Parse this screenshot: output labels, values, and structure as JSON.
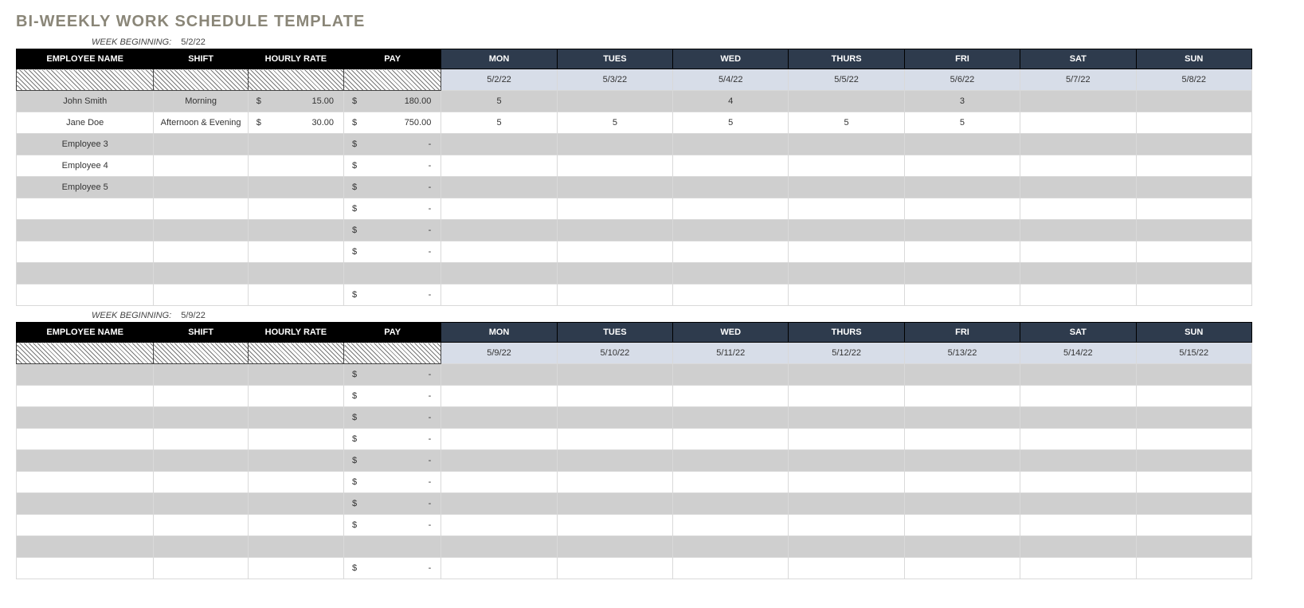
{
  "title": "BI-WEEKLY WORK SCHEDULE TEMPLATE",
  "week_beginning_label": "WEEK BEGINNING:",
  "columns": {
    "employee": "EMPLOYEE NAME",
    "shift": "SHIFT",
    "rate": "HOURLY RATE",
    "pay": "PAY",
    "days": [
      "MON",
      "TUES",
      "WED",
      "THURS",
      "FRI",
      "SAT",
      "SUN"
    ]
  },
  "currency": "$",
  "weeks": [
    {
      "begin_date": "5/2/22",
      "dates": [
        "5/2/22",
        "5/3/22",
        "5/4/22",
        "5/5/22",
        "5/6/22",
        "5/7/22",
        "5/8/22"
      ],
      "rows": [
        {
          "name": "John Smith",
          "shift": "Morning",
          "rate": "15.00",
          "pay": "180.00",
          "hours": [
            "5",
            "",
            "4",
            "",
            "3",
            "",
            ""
          ]
        },
        {
          "name": "Jane Doe",
          "shift": "Afternoon & Evening",
          "rate": "30.00",
          "pay": "750.00",
          "hours": [
            "5",
            "5",
            "5",
            "5",
            "5",
            "",
            ""
          ]
        },
        {
          "name": "Employee 3",
          "shift": "",
          "rate": "",
          "pay": "-",
          "hours": [
            "",
            "",
            "",
            "",
            "",
            "",
            ""
          ]
        },
        {
          "name": "Employee 4",
          "shift": "",
          "rate": "",
          "pay": "-",
          "hours": [
            "",
            "",
            "",
            "",
            "",
            "",
            ""
          ]
        },
        {
          "name": "Employee 5",
          "shift": "",
          "rate": "",
          "pay": "-",
          "hours": [
            "",
            "",
            "",
            "",
            "",
            "",
            ""
          ]
        },
        {
          "name": "",
          "shift": "",
          "rate": "",
          "pay": "-",
          "hours": [
            "",
            "",
            "",
            "",
            "",
            "",
            ""
          ]
        },
        {
          "name": "",
          "shift": "",
          "rate": "",
          "pay": "-",
          "hours": [
            "",
            "",
            "",
            "",
            "",
            "",
            ""
          ]
        },
        {
          "name": "",
          "shift": "",
          "rate": "",
          "pay": "-",
          "hours": [
            "",
            "",
            "",
            "",
            "",
            "",
            ""
          ]
        },
        {
          "name": "",
          "shift": "",
          "rate": "",
          "pay": "",
          "hours": [
            "",
            "",
            "",
            "",
            "",
            "",
            ""
          ],
          "no_currency": true
        },
        {
          "name": "",
          "shift": "",
          "rate": "",
          "pay": "-",
          "hours": [
            "",
            "",
            "",
            "",
            "",
            "",
            ""
          ]
        }
      ]
    },
    {
      "begin_date": "5/9/22",
      "dates": [
        "5/9/22",
        "5/10/22",
        "5/11/22",
        "5/12/22",
        "5/13/22",
        "5/14/22",
        "5/15/22"
      ],
      "rows": [
        {
          "name": "",
          "shift": "",
          "rate": "",
          "pay": "-",
          "hours": [
            "",
            "",
            "",
            "",
            "",
            "",
            ""
          ]
        },
        {
          "name": "",
          "shift": "",
          "rate": "",
          "pay": "-",
          "hours": [
            "",
            "",
            "",
            "",
            "",
            "",
            ""
          ]
        },
        {
          "name": "",
          "shift": "",
          "rate": "",
          "pay": "-",
          "hours": [
            "",
            "",
            "",
            "",
            "",
            "",
            ""
          ]
        },
        {
          "name": "",
          "shift": "",
          "rate": "",
          "pay": "-",
          "hours": [
            "",
            "",
            "",
            "",
            "",
            "",
            ""
          ]
        },
        {
          "name": "",
          "shift": "",
          "rate": "",
          "pay": "-",
          "hours": [
            "",
            "",
            "",
            "",
            "",
            "",
            ""
          ]
        },
        {
          "name": "",
          "shift": "",
          "rate": "",
          "pay": "-",
          "hours": [
            "",
            "",
            "",
            "",
            "",
            "",
            ""
          ]
        },
        {
          "name": "",
          "shift": "",
          "rate": "",
          "pay": "-",
          "hours": [
            "",
            "",
            "",
            "",
            "",
            "",
            ""
          ]
        },
        {
          "name": "",
          "shift": "",
          "rate": "",
          "pay": "-",
          "hours": [
            "",
            "",
            "",
            "",
            "",
            "",
            ""
          ]
        },
        {
          "name": "",
          "shift": "",
          "rate": "",
          "pay": "",
          "hours": [
            "",
            "",
            "",
            "",
            "",
            "",
            ""
          ],
          "no_currency": true
        },
        {
          "name": "",
          "shift": "",
          "rate": "",
          "pay": "-",
          "hours": [
            "",
            "",
            "",
            "",
            "",
            "",
            ""
          ]
        }
      ]
    }
  ]
}
